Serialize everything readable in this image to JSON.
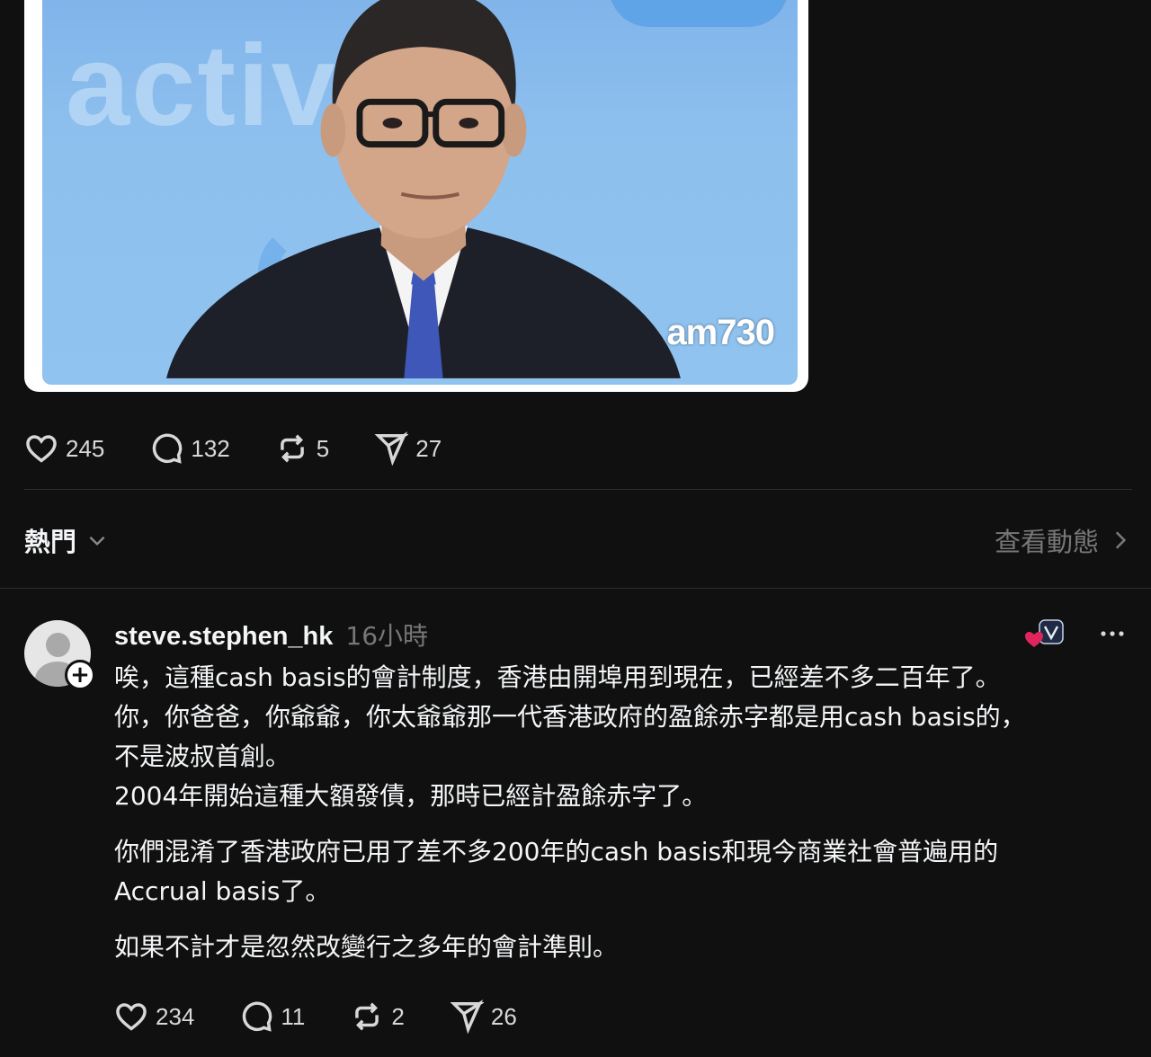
{
  "post": {
    "image": {
      "background_word": "activ",
      "watermark": "am730"
    },
    "actions": {
      "likes": "245",
      "comments": "132",
      "reposts": "5",
      "shares": "27"
    }
  },
  "sort": {
    "label": "熱門",
    "view_activity": "查看動態"
  },
  "reply": {
    "username": "steve.stephen_hk",
    "time": "16小時",
    "follow_symbol": "+",
    "paragraphs": [
      "唉，這種cash basis的會計制度，香港由開埠用到現在，已經差不多二百年了。",
      "你，你爸爸，你爺爺，你太爺爺那一代香港政府的盈餘赤字都是用cash basis的，",
      "不是波叔首創。",
      "2004年開始這種大額發債，那時已經計盈餘赤字了。",
      "你們混淆了香港政府已用了差不多200年的cash basis和現今商業社會普遍用的",
      "Accrual basis了。",
      "如果不計才是忽然改變行之多年的會計準則。"
    ],
    "actions": {
      "likes": "234",
      "comments": "11",
      "reposts": "2",
      "shares": "26"
    }
  },
  "colors": {
    "background": "#101010",
    "text": "#f3f5f7",
    "muted": "#777777",
    "heart": "#e0245e"
  }
}
